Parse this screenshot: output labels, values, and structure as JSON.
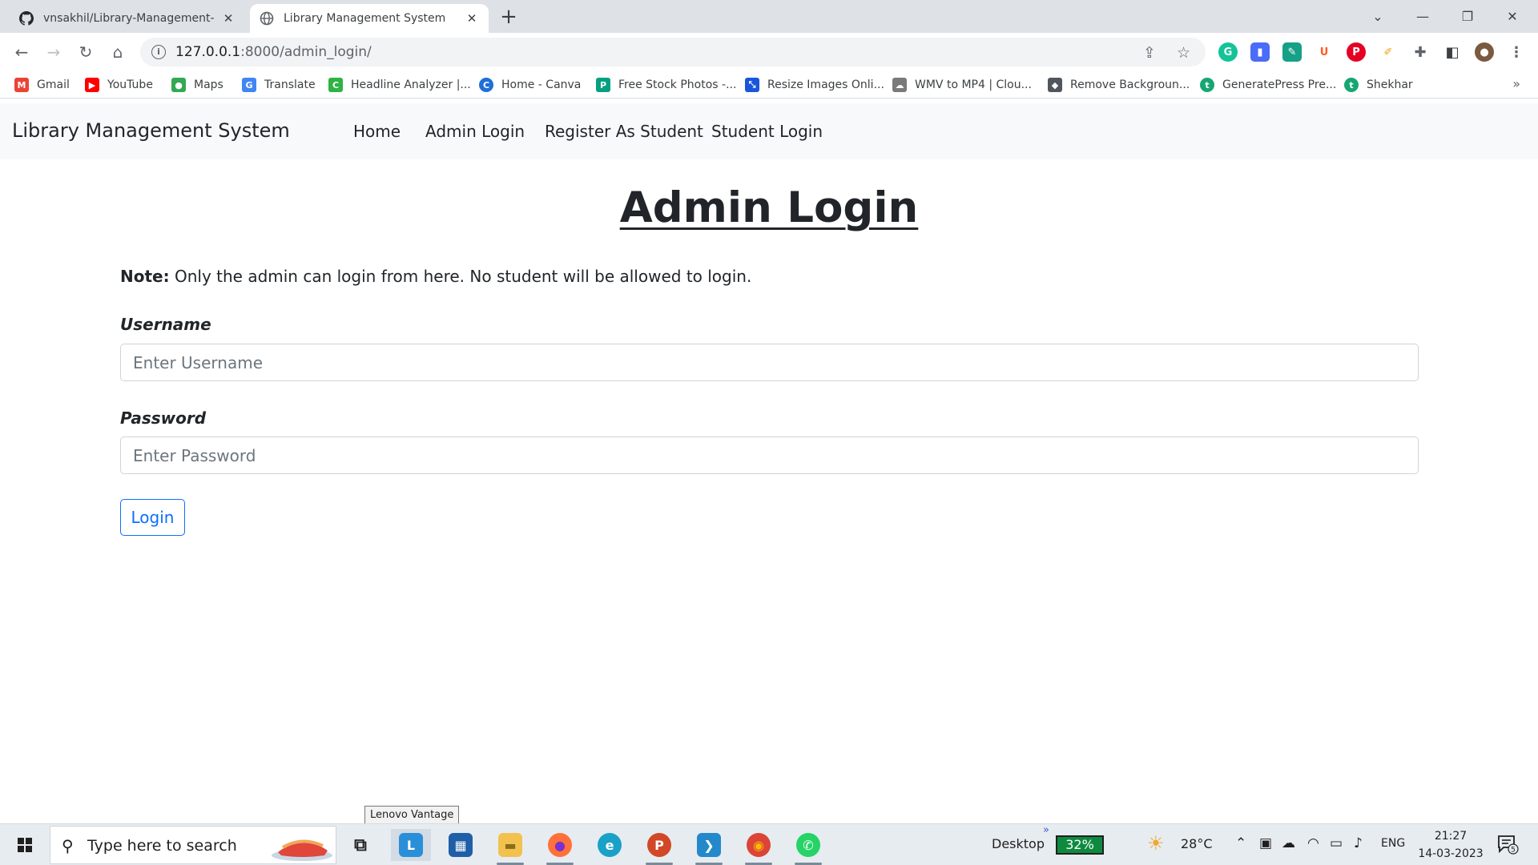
{
  "browser": {
    "tabs": [
      {
        "title": "vnsakhil/Library-Management-Sy",
        "active": false,
        "icon": "github-icon"
      },
      {
        "title": "Library Management System",
        "active": true,
        "icon": "globe-icon"
      }
    ],
    "new_tab_symbol": "+",
    "url_host": "127.0.0.1",
    "url_rest": ":8000/admin_login/",
    "bookmarks": [
      {
        "label": "Gmail",
        "icon": "gmail-icon",
        "color": "#ea4335",
        "glyph": "M"
      },
      {
        "label": "YouTube",
        "icon": "youtube-icon",
        "color": "#ff0000",
        "glyph": "▶"
      },
      {
        "label": "Maps",
        "icon": "maps-icon",
        "color": "#34a853",
        "glyph": "●"
      },
      {
        "label": "Translate",
        "icon": "translate-icon",
        "color": "#4285f4",
        "glyph": "G"
      },
      {
        "label": "Headline Analyzer |...",
        "icon": "coschedule-icon",
        "color": "#2fb344",
        "glyph": "C"
      },
      {
        "label": "Home - Canva",
        "icon": "canva-icon",
        "color": "#1e6fd9",
        "glyph": "C"
      },
      {
        "label": "Free Stock Photos -...",
        "icon": "pexels-icon",
        "color": "#05a081",
        "glyph": "P"
      },
      {
        "label": "Resize Images Onli...",
        "icon": "resize-icon",
        "color": "#1a56db",
        "glyph": "⤡"
      },
      {
        "label": "WMV to MP4 | Clou...",
        "icon": "cloudconvert-icon",
        "color": "#7a7a7a",
        "glyph": "☁"
      },
      {
        "label": "Remove Backgroun...",
        "icon": "removebg-icon",
        "color": "#50565e",
        "glyph": "◆"
      },
      {
        "label": "GeneratePress Pre...",
        "icon": "generatepress-icon",
        "color": "#17a673",
        "glyph": "t"
      },
      {
        "label": "Shekhar",
        "icon": "shekhar-icon",
        "color": "#17a673",
        "glyph": "t"
      }
    ],
    "bookmarks_more": "»"
  },
  "site": {
    "brand": "Library Management System",
    "nav": [
      {
        "label": "Home"
      },
      {
        "label": "Admin Login"
      },
      {
        "label": "Register As Student"
      },
      {
        "label": "Student Login"
      }
    ]
  },
  "form": {
    "title": "Admin Login",
    "note_label": "Note:",
    "note_text": " Only the admin can login from here. No student will be allowed to login.",
    "username_label": "Username",
    "username_placeholder": "Enter Username",
    "password_label": "Password",
    "password_placeholder": "Enter Password",
    "submit_label": "Login"
  },
  "tooltip": "Lenovo Vantage",
  "taskbar": {
    "search_placeholder": "Type here to search",
    "apps": [
      {
        "name": "task-view-icon",
        "glyph": "⧉",
        "color": "#e7ecf1",
        "fg": "#1f1f1f",
        "running": false
      },
      {
        "name": "lenovo-vantage-icon",
        "glyph": "L",
        "color": "#2a8fd8",
        "fg": "#ffffff",
        "running": false
      },
      {
        "name": "microsoft-store-icon",
        "glyph": "▦",
        "color": "#1f5fa8",
        "fg": "#ffffff",
        "running": false
      },
      {
        "name": "file-explorer-icon",
        "glyph": "▬",
        "color": "#f2c14e",
        "fg": "#8a6d1a",
        "running": true
      },
      {
        "name": "firefox-icon",
        "glyph": "●",
        "color": "#ff7139",
        "fg": "#7a2fd0",
        "running": true
      },
      {
        "name": "edge-icon",
        "glyph": "e",
        "color": "#1aa1c8",
        "fg": "#ffffff",
        "running": false
      },
      {
        "name": "powerpoint-icon",
        "glyph": "P",
        "color": "#d24726",
        "fg": "#ffffff",
        "running": true
      },
      {
        "name": "vscode-icon",
        "glyph": "❯",
        "color": "#2489ca",
        "fg": "#ffffff",
        "running": true
      },
      {
        "name": "chrome-icon",
        "glyph": "◉",
        "color": "#db4437",
        "fg": "#fbbc05",
        "running": true
      },
      {
        "name": "whatsapp-icon",
        "glyph": "✆",
        "color": "#25d366",
        "fg": "#ffffff",
        "running": true
      }
    ],
    "desktop_label": "Desktop",
    "chevron": "»",
    "battery": "32%",
    "temperature": "28°C",
    "language": "ENG",
    "time": "21:27",
    "date": "14-03-2023",
    "notification_count": "5"
  },
  "colors": {
    "primary": "#0d6efd",
    "navbar_bg": "#f8f9fa",
    "text": "#212529",
    "muted": "#6c757d"
  }
}
